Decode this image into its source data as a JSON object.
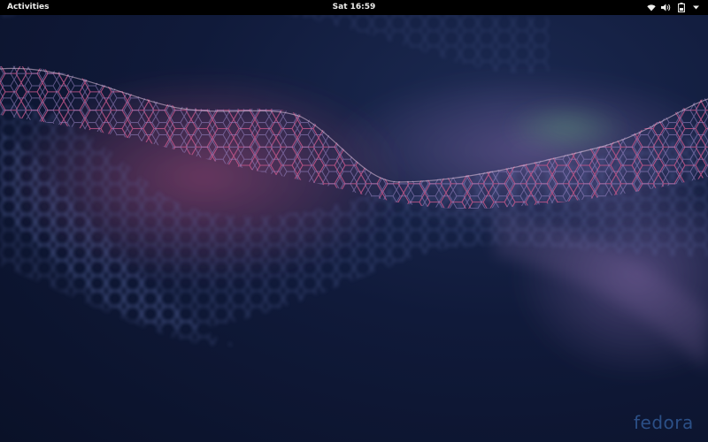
{
  "topbar": {
    "activities_label": "Activities",
    "clock": "Sat 16:59",
    "tray_icons": [
      "wifi-icon",
      "volume-icon",
      "battery-icon",
      "chevron-down-icon"
    ]
  },
  "wallpaper": {
    "logo_text": "fedora",
    "colors": {
      "background": "#0d1530",
      "mesh_pink": "#c4568a",
      "mesh_violet": "#8b74b8",
      "mesh_blue": "#4a5f9a",
      "logo": "#3c6eb4"
    }
  }
}
